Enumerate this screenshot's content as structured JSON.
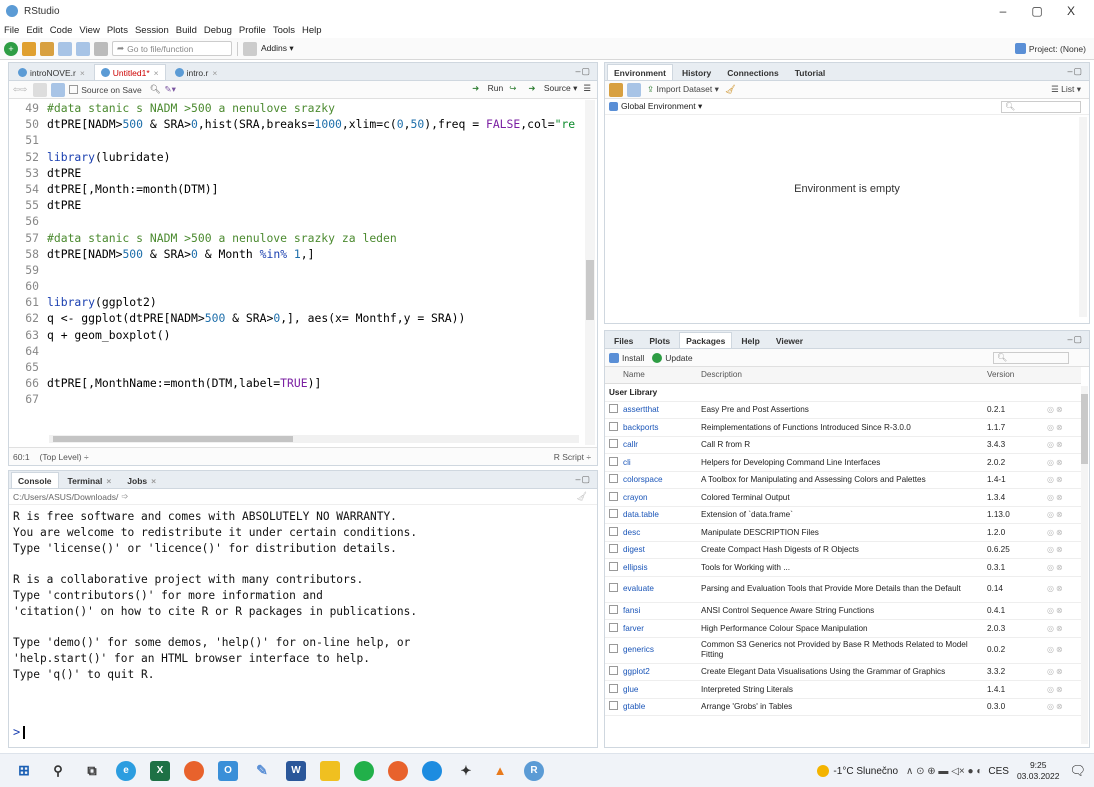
{
  "window": {
    "title": "RStudio",
    "controls": [
      "–",
      "▢",
      "X"
    ]
  },
  "menu": [
    "File",
    "Edit",
    "Code",
    "View",
    "Plots",
    "Session",
    "Build",
    "Debug",
    "Profile",
    "Tools",
    "Help"
  ],
  "toolbar": {
    "goto_placeholder": "Go to file/function",
    "addins": "Addins ▾",
    "project": "Project: (None)"
  },
  "editor": {
    "tabs": [
      {
        "label": "introNOVE.r",
        "active": false,
        "unsaved": false
      },
      {
        "label": "Untitled1*",
        "active": true,
        "unsaved": true
      },
      {
        "label": "intro.r",
        "active": false,
        "unsaved": false
      }
    ],
    "source_on_save": "Source on Save",
    "run": "Run",
    "source": "Source ▾",
    "lines": [
      {
        "n": "49",
        "html": "<span class='cmt'>#data stanic s NADM &gt;500 a nenulove srazky</span>"
      },
      {
        "n": "50",
        "html": "dtPRE[NADM&gt;<span class='num'>500</span> &amp; SRA&gt;<span class='num'>0</span>,hist(SRA,breaks=<span class='num'>1000</span>,xlim=c(<span class='num'>0</span>,<span class='num'>50</span>),freq = <span class='cons'>FALSE</span>,col=<span class='str'>\"re</span>"
      },
      {
        "n": "51",
        "html": ""
      },
      {
        "n": "52",
        "html": "<span class='kw'>library</span>(lubridate)"
      },
      {
        "n": "53",
        "html": "dtPRE"
      },
      {
        "n": "54",
        "html": "dtPRE[,Month:=month(DTM)]"
      },
      {
        "n": "55",
        "html": "dtPRE"
      },
      {
        "n": "56",
        "html": ""
      },
      {
        "n": "57",
        "html": "<span class='cmt'>#data stanic s NADM &gt;500 a nenulove srazky za leden</span>"
      },
      {
        "n": "58",
        "html": "dtPRE[NADM&gt;<span class='num'>500</span> &amp; SRA&gt;<span class='num'>0</span> &amp; Month <span class='kw'>%in%</span> <span class='num'>1</span>,]"
      },
      {
        "n": "59",
        "html": ""
      },
      {
        "n": "60",
        "html": ""
      },
      {
        "n": "61",
        "html": "<span class='kw'>library</span>(ggplot2)"
      },
      {
        "n": "62",
        "html": "q &lt;- ggplot(dtPRE[NADM&gt;<span class='num'>500</span> &amp; SRA&gt;<span class='num'>0</span>,], aes(x= Monthf,y = SRA))"
      },
      {
        "n": "63",
        "html": "q + geom_boxplot()"
      },
      {
        "n": "64",
        "html": ""
      },
      {
        "n": "65",
        "html": ""
      },
      {
        "n": "66",
        "html": "dtPRE[,MonthName:=month(DTM,label=<span class='cons'>TRUE</span>)]"
      },
      {
        "n": "67",
        "html": ""
      }
    ],
    "status_pos": "60:1",
    "status_level": "(Top Level) ÷",
    "status_type": "R Script ÷"
  },
  "console": {
    "tabs": [
      "Console",
      "Terminal",
      "Jobs"
    ],
    "path": "C:/Users/ASUS/Downloads/",
    "text": "R is free software and comes with ABSOLUTELY NO WARRANTY.\nYou are welcome to redistribute it under certain conditions.\nType 'license()' or 'licence()' for distribution details.\n\nR is a collaborative project with many contributors.\nType 'contributors()' for more information and\n'citation()' on how to cite R or R packages in publications.\n\nType 'demo()' for some demos, 'help()' for on-line help, or\n'help.start()' for an HTML browser interface to help.\nType 'q()' to quit R.",
    "prompt": ">"
  },
  "environment": {
    "tabs": [
      "Environment",
      "History",
      "Connections",
      "Tutorial"
    ],
    "import": "Import Dataset ▾",
    "list": "☰ List ▾",
    "global": "Global Environment ▾",
    "empty_msg": "Environment is empty"
  },
  "packages": {
    "tabs": [
      "Files",
      "Plots",
      "Packages",
      "Help",
      "Viewer"
    ],
    "install": "Install",
    "update": "Update",
    "columns": [
      "",
      "Name",
      "Description",
      "Version",
      ""
    ],
    "group": "User Library",
    "rows": [
      {
        "name": "assertthat",
        "desc": "Easy Pre and Post Assertions",
        "ver": "0.2.1"
      },
      {
        "name": "backports",
        "desc": "Reimplementations of Functions Introduced Since R-3.0.0",
        "ver": "1.1.7"
      },
      {
        "name": "callr",
        "desc": "Call R from R",
        "ver": "3.4.3"
      },
      {
        "name": "cli",
        "desc": "Helpers for Developing Command Line Interfaces",
        "ver": "2.0.2"
      },
      {
        "name": "colorspace",
        "desc": "A Toolbox for Manipulating and Assessing Colors and Palettes",
        "ver": "1.4-1"
      },
      {
        "name": "crayon",
        "desc": "Colored Terminal Output",
        "ver": "1.3.4"
      },
      {
        "name": "data.table",
        "desc": "Extension of `data.frame`",
        "ver": "1.13.0"
      },
      {
        "name": "desc",
        "desc": "Manipulate DESCRIPTION Files",
        "ver": "1.2.0"
      },
      {
        "name": "digest",
        "desc": "Create Compact Hash Digests of R Objects",
        "ver": "0.6.25"
      },
      {
        "name": "ellipsis",
        "desc": "Tools for Working with ...",
        "ver": "0.3.1"
      },
      {
        "name": "evaluate",
        "desc": "Parsing and Evaluation Tools that Provide More Details than the Default",
        "ver": "0.14",
        "tall": true
      },
      {
        "name": "fansi",
        "desc": "ANSI Control Sequence Aware String Functions",
        "ver": "0.4.1"
      },
      {
        "name": "farver",
        "desc": "High Performance Colour Space Manipulation",
        "ver": "2.0.3"
      },
      {
        "name": "generics",
        "desc": "Common S3 Generics not Provided by Base R Methods Related to Model Fitting",
        "ver": "0.0.2",
        "tall": true
      },
      {
        "name": "ggplot2",
        "desc": "Create Elegant Data Visualisations Using the Grammar of Graphics",
        "ver": "3.3.2"
      },
      {
        "name": "glue",
        "desc": "Interpreted String Literals",
        "ver": "1.4.1"
      },
      {
        "name": "gtable",
        "desc": "Arrange 'Grobs' in Tables",
        "ver": "0.3.0"
      }
    ]
  },
  "taskbar": {
    "weather": "-1°C Slunečno",
    "lang": "CES",
    "time": "9:25",
    "date": "03.03.2022"
  },
  "colors": {
    "accent": "#5b9bd5",
    "comment": "#4b8a2f",
    "keyword": "#1a3fb0",
    "pane_border": "#cfd7df"
  }
}
